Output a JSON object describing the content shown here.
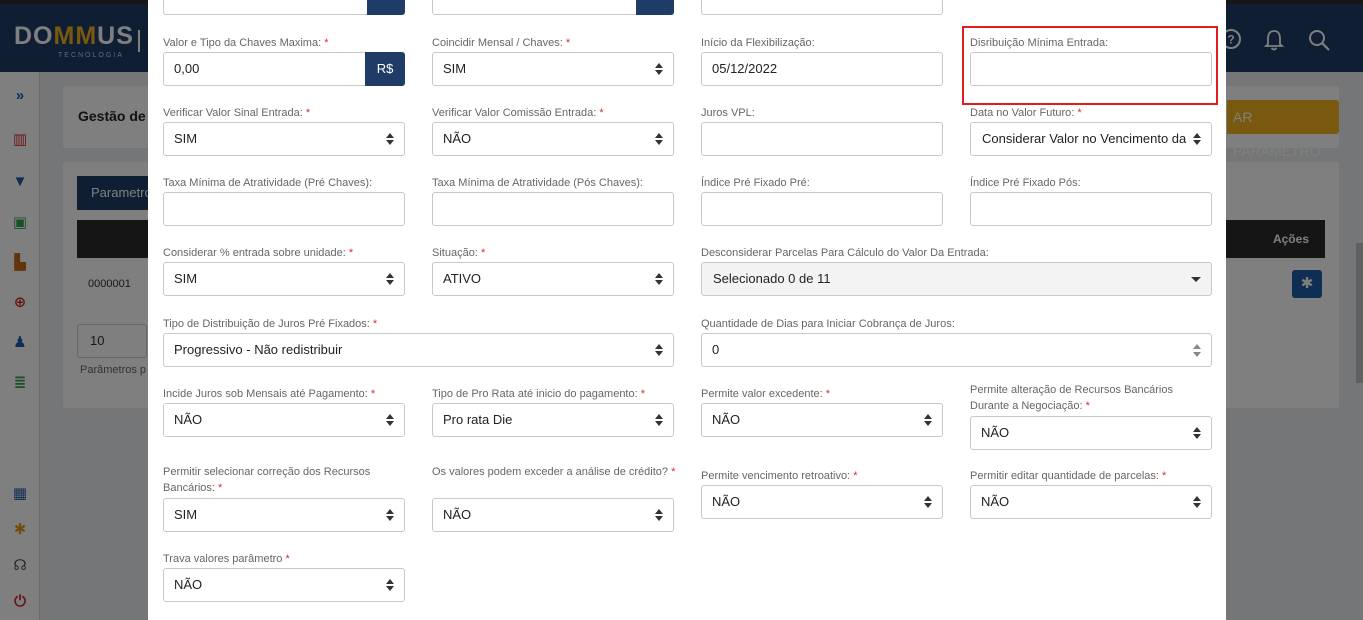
{
  "app": {
    "logo_left": "DO",
    "logo_mid": "MM",
    "logo_right": "US",
    "logo_sub": "TECNOLOGIA",
    "page_title": "Gestão de",
    "add_button": "AR PARÂMETRO",
    "tab_label": "Parametro",
    "table_header_actions": "Ações",
    "row_id": "0000001",
    "per_page": "10",
    "per_page_label": "Parâmetros p",
    "icons": [
      "help-icon",
      "bell-icon",
      "search-icon"
    ],
    "sidebar_icons": [
      "expand-icon",
      "chart-icon",
      "filter-icon",
      "calendar-icon",
      "building-icon",
      "plus-circle-icon",
      "user-plus-icon",
      "coins-icon",
      "grid-icon",
      "gear-icon",
      "headset-icon",
      "power-icon"
    ]
  },
  "form": {
    "currency_addon": "R$",
    "fields": {
      "valor_tipo_chaves": {
        "label": "Valor e Tipo da Chaves Maxima:",
        "value": "0,00"
      },
      "coincidir_mensal": {
        "label": "Coincidir Mensal / Chaves:",
        "value": "SIM"
      },
      "inicio_flex": {
        "label": "Início da Flexibilização:",
        "value": "05/12/2022"
      },
      "distribuicao_minima": {
        "label": "Disribuição Mínima Entrada:",
        "value": ""
      },
      "verificar_sinal": {
        "label": "Verificar Valor Sinal Entrada:",
        "value": "SIM"
      },
      "verificar_comissao": {
        "label": "Verificar Valor Comissão Entrada:",
        "value": "NÃO"
      },
      "juros_vpl": {
        "label": "Juros VPL:",
        "value": ""
      },
      "data_valor_futuro": {
        "label": "Data no Valor Futuro:",
        "value": "Considerar Valor no Vencimento da"
      },
      "taxa_pre": {
        "label": "Taxa Mínima de Atratividade (Pré Chaves):",
        "value": ""
      },
      "taxa_pos": {
        "label": "Taxa Mínima de Atratividade (Pós Chaves):",
        "value": ""
      },
      "indice_pre": {
        "label": "Índice Pré Fixado Pré:",
        "value": ""
      },
      "indice_pos": {
        "label": "Índice Pré Fixado Pós:",
        "value": ""
      },
      "considerar_entrada": {
        "label": "Considerar % entrada sobre unidade:",
        "value": "SIM"
      },
      "situacao": {
        "label": "Situação:",
        "value": "ATIVO"
      },
      "desconsiderar_parcelas": {
        "label": "Desconsiderar Parcelas Para Cálculo do Valor Da Entrada:",
        "value": "Selecionado 0 de 11"
      },
      "tipo_distribuicao": {
        "label": "Tipo de Distribuição de Juros Pré Fixados:",
        "value": "Progressivo - Não redistribuir"
      },
      "qtd_dias": {
        "label": "Quantidade de Dias para Iniciar Cobrança de Juros:",
        "value": "0"
      },
      "incide_juros": {
        "label": "Incide Juros sob Mensais até Pagamento:",
        "value": "NÃO"
      },
      "pro_rata": {
        "label": "Tipo de Pro Rata até inicio do pagamento:",
        "value": "Pro rata Die"
      },
      "valor_excedente": {
        "label": "Permite valor excedente:",
        "value": "NÃO"
      },
      "alteracao_recursos": {
        "label": "Permite alteração de Recursos Bancários Durante a Negociação:",
        "value": "NÃO"
      },
      "correcao_recursos": {
        "label": "Permitir selecionar correção dos Recursos Bancários:",
        "value": "SIM"
      },
      "exceder_credito": {
        "label": "Os valores podem exceder a análise de crédito?",
        "value": "NÃO"
      },
      "vencimento_retroativo": {
        "label": "Permite vencimento retroativo:",
        "value": "NÃO"
      },
      "editar_parcelas": {
        "label": "Permitir editar quantidade de parcelas:",
        "value": "NÃO"
      },
      "trava_valores": {
        "label": "Trava valores parâmetro",
        "value": "NÃO"
      }
    },
    "required_mark": "*"
  }
}
